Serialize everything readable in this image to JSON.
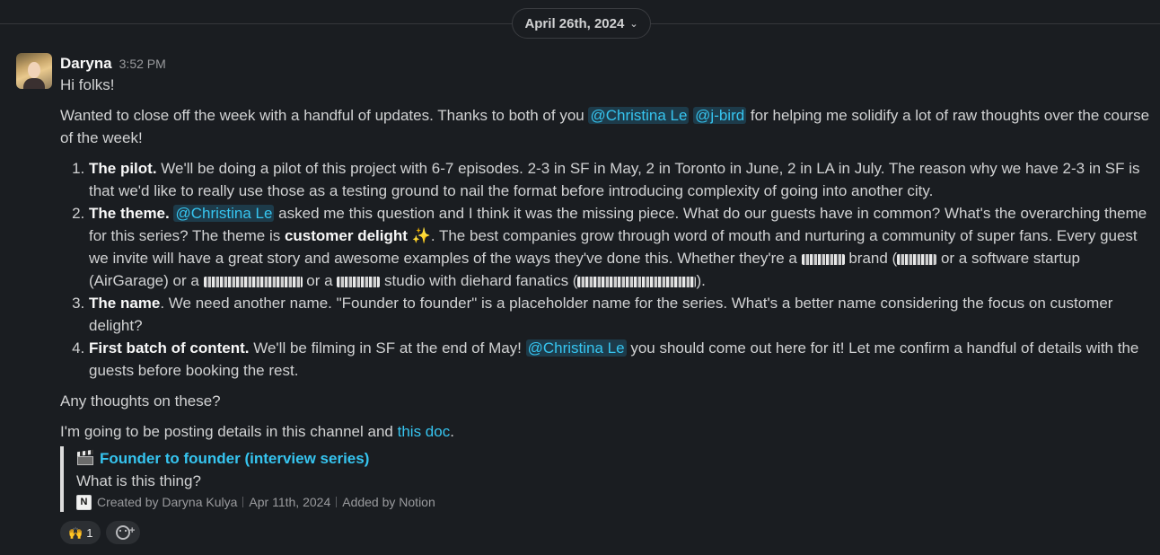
{
  "date_divider": {
    "label": "April 26th, 2024",
    "chevron_icon": "chevron-down-icon"
  },
  "message": {
    "author": "Daryna",
    "time": "3:52 PM",
    "greeting": "Hi folks!",
    "intro": {
      "before": "Wanted to close off the week with a handful of updates. Thanks to both of you ",
      "mention1": "@Christina Le",
      "mention2": "@j-bird",
      "after": " for helping me solidify a lot of raw thoughts over the course of the week!"
    },
    "items": [
      {
        "heading": "The pilot.",
        "text": " We'll be doing a pilot of this project with 6-7 episodes. 2-3 in SF in May, 2 in Toronto in June, 2 in LA in July. The reason why we have 2-3 in SF is that we'd like to really use those as a testing ground to nail the format before introducing complexity of going into another city."
      },
      {
        "heading": "The theme.",
        "mention": "@Christina Le",
        "text1": " asked me this question and I think it was the missing piece. What do our guests have in common? What's the overarching theme for this series? The theme is ",
        "bold": "customer delight",
        "sparkles": "✨",
        "text2": ". The best companies grow through word of mouth and nurturing a community of super fans. Every guest we invite will have a great story and awesome examples of the ways they've done this. Whether they're a ",
        "text3": " brand (",
        "text4": " or a software startup (AirGarage) or a ",
        "text5": " or a ",
        "text6": " studio with diehard fanatics (",
        "text7": ")."
      },
      {
        "heading": "The name",
        "text": ". We need another name. \"Founder to founder\" is a placeholder name for the series. What's a better name considering the focus on customer delight?"
      },
      {
        "heading": "First batch of content.",
        "text1": " We'll be filming in SF at the end of May! ",
        "mention": "@Christina Le",
        "text2": " you should come out here for it! Let me confirm a handful of details with the guests before booking the rest."
      }
    ],
    "question": "Any thoughts on these?",
    "closing": {
      "before": "I'm going to be posting details in this channel and ",
      "link": "this doc",
      "after": "."
    },
    "attachment": {
      "title": "Founder to founder (interview series)",
      "subtitle": "What is this thing?",
      "created_by": "Created by Daryna Kulya",
      "date": "Apr 11th, 2024",
      "added_by": "Added by Notion",
      "icon": "clapperboard-icon",
      "source_icon": "notion-icon"
    },
    "reactions": [
      {
        "emoji": "🙌",
        "count": "1"
      }
    ],
    "add_reaction_icon": "add-reaction-icon",
    "colors": {
      "mention_bg": "#1d3b4a",
      "mention_fg": "#36c5f0",
      "background": "#1a1d21"
    }
  }
}
